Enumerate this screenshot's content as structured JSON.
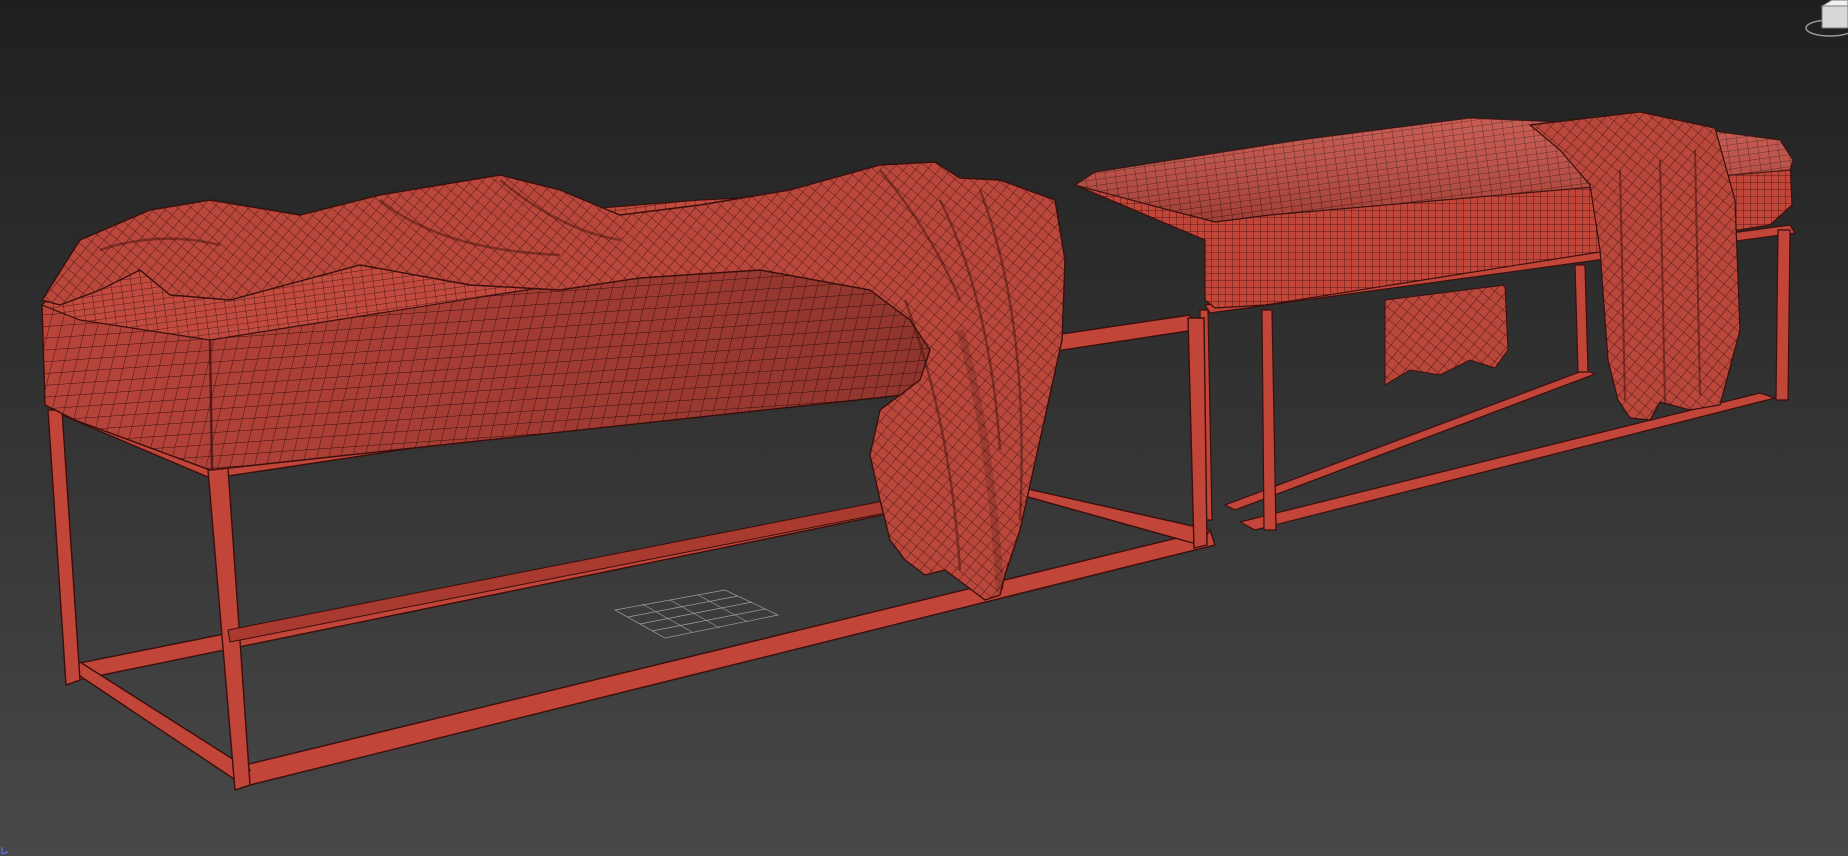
{
  "viewport": {
    "background_top": "#1f1f1f",
    "background_bottom": "#484848"
  },
  "model": {
    "wire_color": "#c2453a",
    "wire_dark": "#3a0f0c",
    "wire_light": "#d85a4c"
  },
  "viewcube": {
    "icon": "viewcube-icon"
  },
  "axis_tripod": {
    "icon": "axis-tripod-icon",
    "color": "#6a6aff"
  }
}
